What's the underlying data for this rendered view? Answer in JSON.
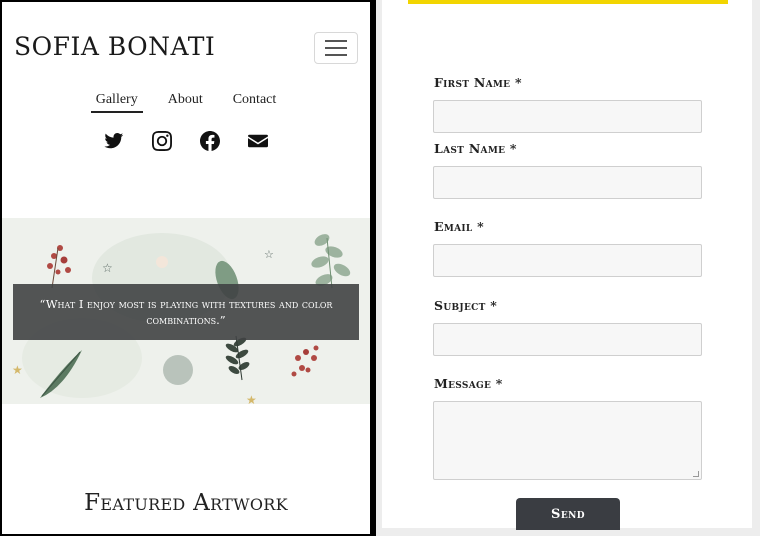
{
  "brand": {
    "name": "SOFIA BONATI"
  },
  "nav": {
    "items": [
      {
        "label": "Gallery",
        "active": true
      },
      {
        "label": "About",
        "active": false
      },
      {
        "label": "Contact",
        "active": false
      }
    ]
  },
  "social": [
    "twitter-icon",
    "instagram-icon",
    "facebook-icon",
    "envelope-icon"
  ],
  "hero": {
    "quote": "“What I enjoy most is playing with textures and color combinations.”"
  },
  "featured": {
    "title": "Featured Artwork"
  },
  "form": {
    "first_name_label": "First Name *",
    "last_name_label": "Last Name *",
    "email_label": "Email *",
    "subject_label": "Subject *",
    "message_label": "Message *",
    "first_name_value": "",
    "last_name_value": "",
    "email_value": "",
    "subject_value": "",
    "message_value": "",
    "send_label": "Send"
  },
  "colors": {
    "accent_bar": "#f2d500",
    "button_bg": "#3a3d42",
    "quote_bg": "#404244"
  }
}
